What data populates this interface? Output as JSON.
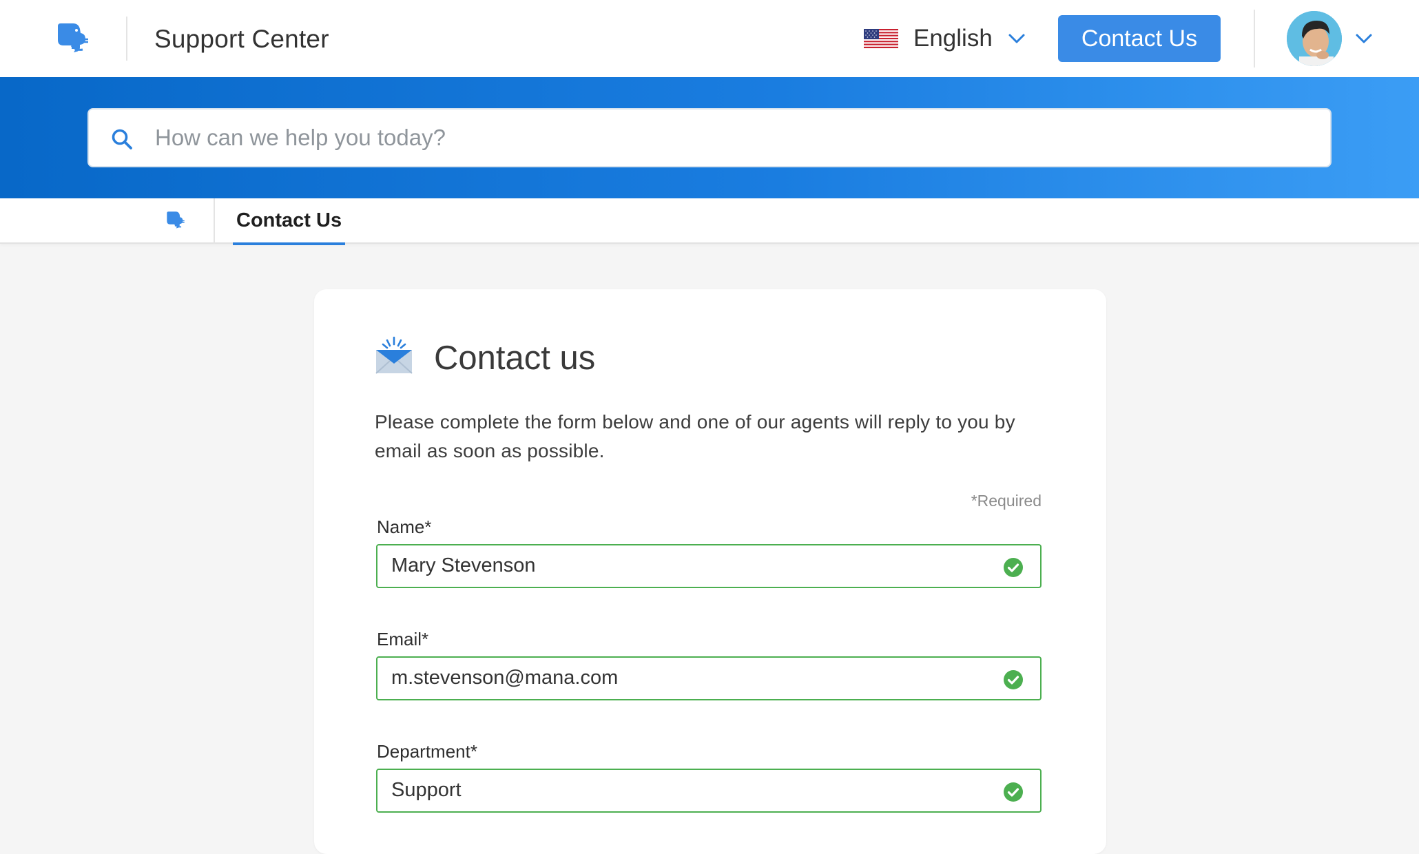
{
  "header": {
    "title": "Support Center",
    "language": "English",
    "contact_button": "Contact Us",
    "logo_icon": "elephant-logo-icon",
    "avatar_icon": "user-avatar"
  },
  "search": {
    "placeholder": "How can we help you today?"
  },
  "breadcrumb": {
    "home_icon": "elephant-logo-icon",
    "current": "Contact Us"
  },
  "form": {
    "title": "Contact us",
    "description": "Please complete the form below and one of our agents will reply to you by email as soon as possible.",
    "required_note": "*Required",
    "fields": [
      {
        "label": "Name*",
        "value": "Mary Stevenson",
        "valid": true
      },
      {
        "label": "Email*",
        "value": "m.stevenson@mana.com",
        "valid": true
      },
      {
        "label": "Department*",
        "value": "Support",
        "valid": true
      }
    ]
  },
  "colors": {
    "brand_blue": "#3a8be6",
    "hero_start": "#0868c8",
    "hero_end": "#3b9df5",
    "valid_green": "#4caf50"
  }
}
